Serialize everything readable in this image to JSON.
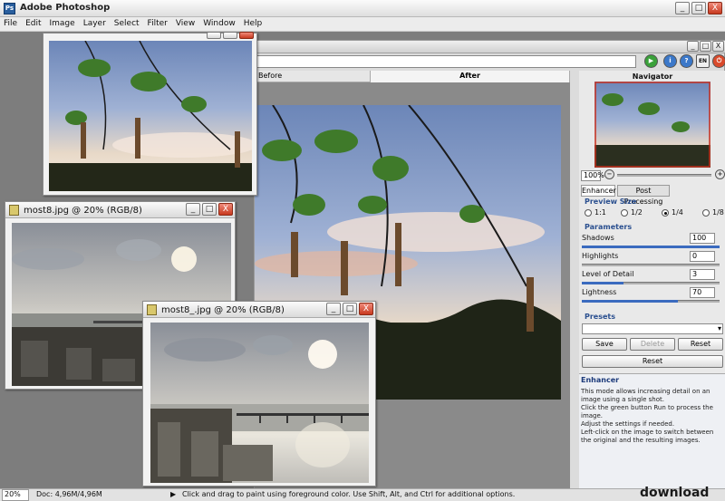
{
  "app": {
    "title": "Adobe Photoshop"
  },
  "menu": [
    "File",
    "Edit",
    "Image",
    "Layer",
    "Select",
    "Filter",
    "View",
    "Window",
    "Help"
  ],
  "window_controls": {
    "minimize": "_",
    "maximize": "□",
    "close": "X"
  },
  "plugin": {
    "tabs": {
      "before": "Before",
      "after": "After"
    },
    "toolbar": {
      "info": "i",
      "help": "?",
      "lang": "EN"
    },
    "navigator": {
      "title": "Navigator",
      "zoom": "100%",
      "zoom_out": "−",
      "zoom_in": "+"
    },
    "side_tabs": {
      "enhancer": "Enhancer",
      "post": "Post Processing"
    },
    "preview_size": {
      "label": "Preview Size",
      "options": [
        "1:1",
        "1/2",
        "1/4",
        "1/8"
      ],
      "selected": "1/4"
    },
    "parameters": {
      "label": "Parameters",
      "items": [
        {
          "name": "Shadows",
          "value": "100",
          "level": 1.0
        },
        {
          "name": "Highlights",
          "value": "0",
          "level": 0.0
        },
        {
          "name": "Level of Detail",
          "value": "3",
          "level": 0.3
        },
        {
          "name": "Lightness",
          "value": "70",
          "level": 0.7
        }
      ]
    },
    "presets": {
      "label": "Presets",
      "save": "Save",
      "delete": "Delete",
      "reset": "Reset"
    },
    "reset_all": "Reset",
    "help": {
      "title": "Enhancer",
      "lines": [
        "This mode allows increasing detail on an image using a single shot.",
        "Click the green button Run to process the image.",
        "Adjust the settings if needed.",
        "Left-click on the image to switch between the original and the resulting images."
      ]
    }
  },
  "documents": [
    {
      "title": "most8.jpg @ 20% (RGB/8)"
    },
    {
      "title": "most8_.jpg @ 20% (RGB/8)"
    }
  ],
  "status": {
    "zoom": "20%",
    "doc": "Doc: 4,96M/4,96M",
    "hint": "Click and drag to paint using foreground color.  Use Shift, Alt, and Ctrl for additional options.",
    "watermark": "download"
  },
  "colors": {
    "accent": "#2a4f8f",
    "run": "#3aa13a",
    "close": "#c8391f"
  }
}
